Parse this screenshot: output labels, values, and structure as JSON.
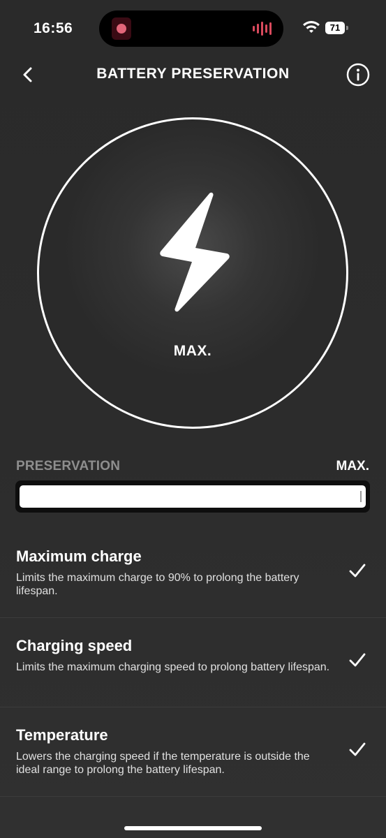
{
  "status_bar": {
    "time": "16:56",
    "battery_level": "71"
  },
  "header": {
    "title": "BATTERY PRESERVATION",
    "back_icon": "chevron-left-icon",
    "info_icon": "info-icon"
  },
  "gauge": {
    "icon": "lightning-bolt-icon",
    "level_label": "MAX."
  },
  "preservation": {
    "label": "PRESERVATION",
    "value_label": "MAX.",
    "slider_fraction": 1.0
  },
  "options": [
    {
      "title": "Maximum charge",
      "description": "Limits the maximum charge to 90% to prolong the battery lifespan.",
      "checked": true
    },
    {
      "title": "Charging speed",
      "description": "Limits the maximum charging speed to prolong battery lifespan.",
      "checked": true
    },
    {
      "title": "Temperature",
      "description": "Lowers the charging speed if the temperature is outside the ideal range to prolong the battery lifespan.",
      "checked": true
    }
  ],
  "colors": {
    "background": "#2c2c2c",
    "accent": "#ffffff",
    "muted": "#8e8e8e",
    "island_accent": "#d94a5d"
  }
}
